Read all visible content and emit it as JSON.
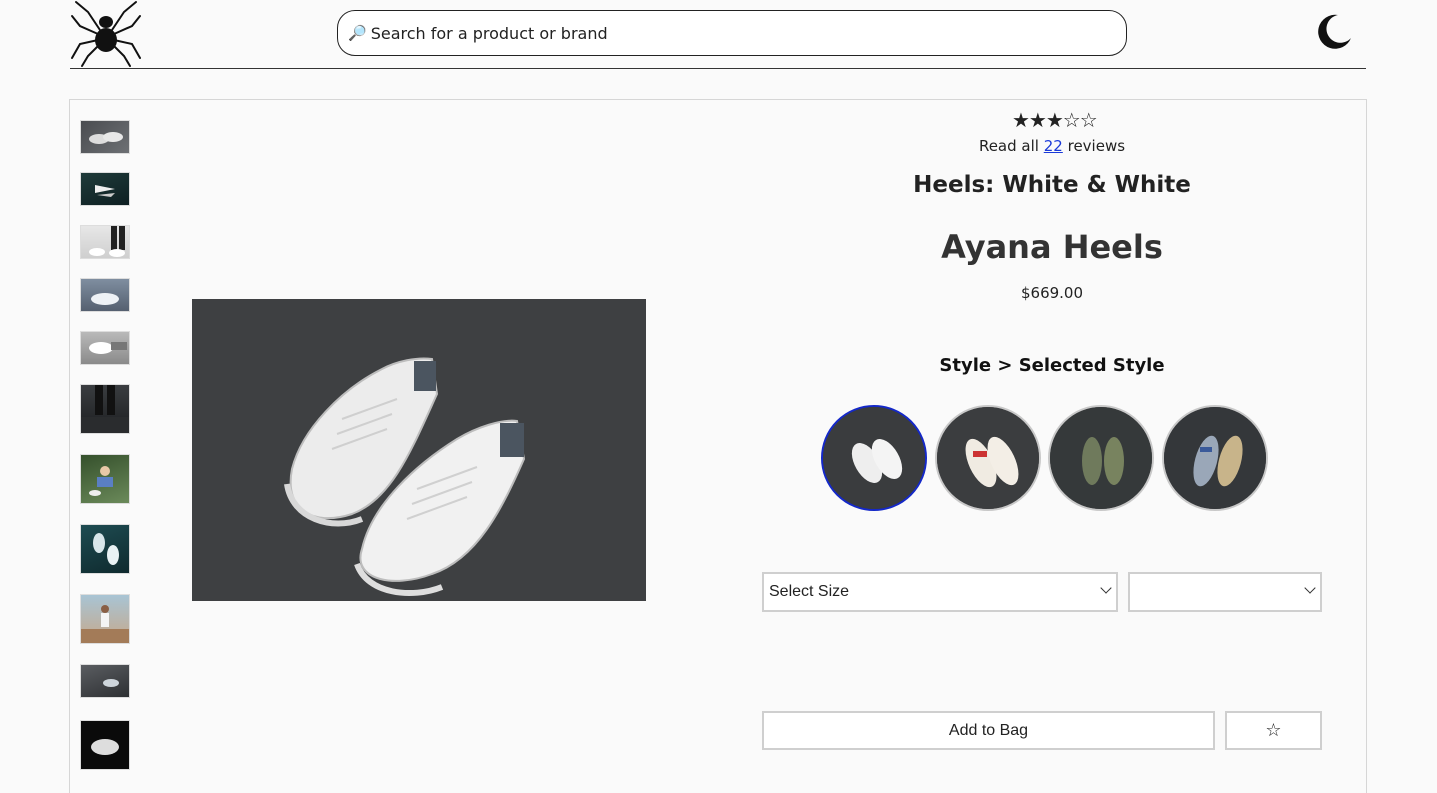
{
  "header": {
    "search": {
      "placeholder": "Search for a product or brand",
      "icon": "magnifier-icon"
    },
    "logo_icon": "spider-logo-icon",
    "theme_toggle_icon": "moon-icon"
  },
  "gallery": {
    "thumbnail_count": 11
  },
  "product": {
    "rating": {
      "value": 3,
      "max": 5,
      "stars_display": "★★★☆☆"
    },
    "reviews": {
      "prefix": "Read all",
      "count": "22",
      "suffix": "reviews"
    },
    "category": "Heels: White & White",
    "name": "Ayana Heels",
    "price": "$669.00",
    "style_heading": "Style > Selected Style",
    "styles_count": 4,
    "selected_style_index": 0
  },
  "purchase": {
    "size_select": "Select Size",
    "quantity_select": "",
    "add_to_bag": "Add to Bag",
    "favorite_icon": "☆"
  },
  "colors": {
    "selected_border": "#1428c8",
    "link": "#1a3ad9"
  }
}
